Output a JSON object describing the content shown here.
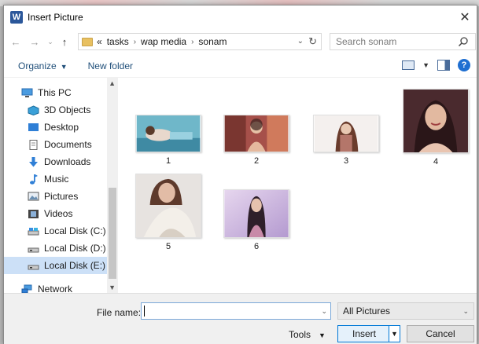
{
  "window": {
    "title": "Insert Picture",
    "app_icon_letter": "W",
    "accent": "#2b579a"
  },
  "address": {
    "breadcrumbs": [
      "tasks",
      "wap media",
      "sonam"
    ],
    "overflow_marker": "«"
  },
  "search": {
    "placeholder": "Search sonam"
  },
  "toolbar": {
    "organize_label": "Organize",
    "new_folder_label": "New folder"
  },
  "nav_pane": {
    "items": [
      {
        "label": "This PC",
        "icon": "computer-icon"
      },
      {
        "label": "3D Objects",
        "icon": "cube-icon"
      },
      {
        "label": "Desktop",
        "icon": "desktop-icon"
      },
      {
        "label": "Documents",
        "icon": "document-icon"
      },
      {
        "label": "Downloads",
        "icon": "download-icon"
      },
      {
        "label": "Music",
        "icon": "music-note-icon"
      },
      {
        "label": "Pictures",
        "icon": "picture-icon"
      },
      {
        "label": "Videos",
        "icon": "film-icon"
      },
      {
        "label": "Local Disk (C:)",
        "icon": "drive-icon"
      },
      {
        "label": "Local Disk (D:)",
        "icon": "drive-icon"
      },
      {
        "label": "Local Disk (E:)",
        "icon": "drive-icon",
        "selected": true
      },
      {
        "label": "Network",
        "icon": "network-icon"
      }
    ]
  },
  "files": [
    {
      "name": "1"
    },
    {
      "name": "2"
    },
    {
      "name": "3"
    },
    {
      "name": "4"
    },
    {
      "name": "5"
    },
    {
      "name": "6"
    }
  ],
  "bottom": {
    "file_name_label": "File name:",
    "file_name_value": "",
    "filter_value": "All Pictures",
    "tools_label": "Tools",
    "insert_label": "Insert",
    "cancel_label": "Cancel"
  }
}
